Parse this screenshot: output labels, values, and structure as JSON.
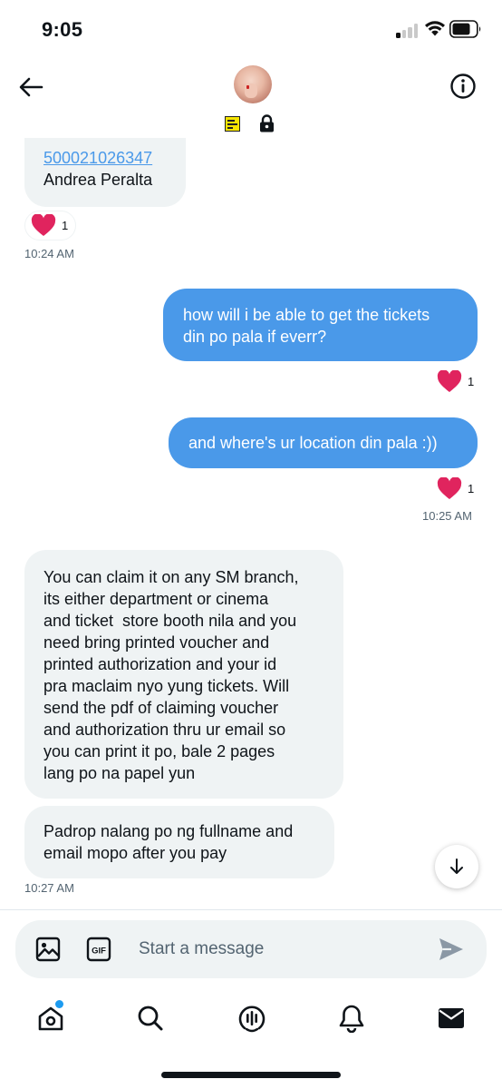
{
  "status_bar": {
    "time": "9:05"
  },
  "header": {
    "back_icon": "arrow-left-icon",
    "info_icon": "info-circle-icon",
    "badge_icon": "ticket-badge-icon",
    "lock_icon": "lock-icon"
  },
  "messages": {
    "m1": {
      "link": "500021026347",
      "name": "Andrea Peralta",
      "reaction_count": "1",
      "time": "10:24 AM"
    },
    "m2": {
      "line1": "how will i be able to get the tickets",
      "line2": "din po pala if everr?",
      "reaction_count": "1"
    },
    "m3": {
      "text": "and where's ur location din pala :))",
      "reaction_count": "1",
      "time": "10:25 AM"
    },
    "m4": {
      "lines": [
        "You can claim it on any SM branch,",
        "its either department or cinema",
        "and ticket  store booth nila and you",
        "need bring printed voucher and",
        "printed authorization and your id",
        "pra maclaim nyo yung tickets. Will",
        "send the pdf of claiming voucher",
        "and authorization thru ur email so",
        "you can print it po, bale 2 pages",
        "lang po na papel yun"
      ]
    },
    "m5": {
      "line1": "Padrop nalang po ng fullname and",
      "line2": "email mopo after you pay",
      "time": "10:27 AM"
    }
  },
  "composer": {
    "placeholder": "Start a message",
    "gif_label": "GIF"
  },
  "nav": {
    "items": [
      "home-icon",
      "search-icon",
      "spaces-icon",
      "notifications-icon",
      "messages-icon"
    ]
  },
  "colors": {
    "accent": "#1d9bf0",
    "outgoing_bubble": "#4a99e9",
    "incoming_bubble": "#eff3f4",
    "heart": "#e0245e"
  }
}
